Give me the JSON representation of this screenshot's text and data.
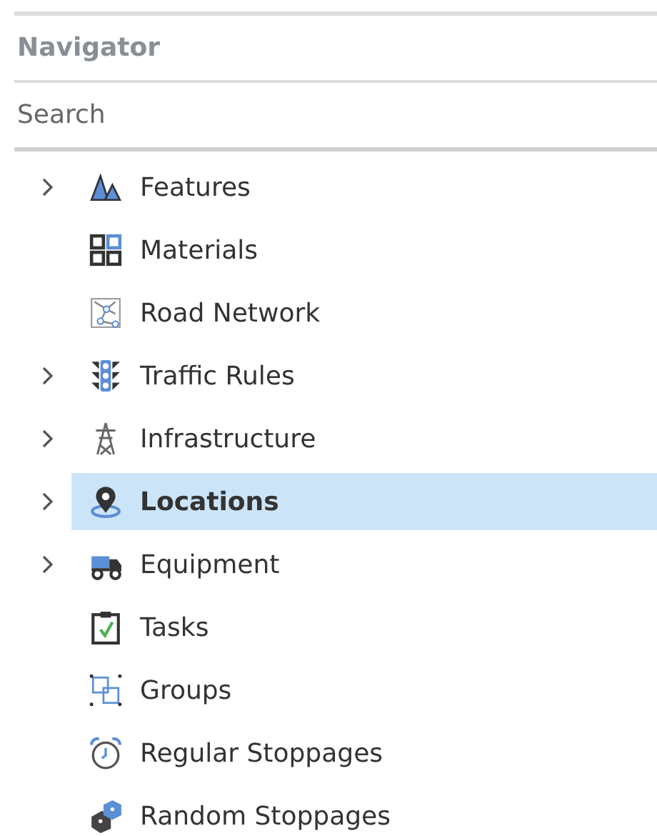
{
  "panel": {
    "title": "Navigator"
  },
  "search": {
    "placeholder": "Search"
  },
  "tree": {
    "items": [
      {
        "label": "Features",
        "expandable": true,
        "selected": false
      },
      {
        "label": "Materials",
        "expandable": false,
        "selected": false
      },
      {
        "label": "Road Network",
        "expandable": false,
        "selected": false
      },
      {
        "label": "Traffic Rules",
        "expandable": true,
        "selected": false
      },
      {
        "label": "Infrastructure",
        "expandable": true,
        "selected": false
      },
      {
        "label": "Locations",
        "expandable": true,
        "selected": true
      },
      {
        "label": "Equipment",
        "expandable": true,
        "selected": false
      },
      {
        "label": "Tasks",
        "expandable": false,
        "selected": false
      },
      {
        "label": "Groups",
        "expandable": false,
        "selected": false
      },
      {
        "label": "Regular Stoppages",
        "expandable": false,
        "selected": false
      },
      {
        "label": "Random Stoppages",
        "expandable": false,
        "selected": false
      }
    ]
  }
}
